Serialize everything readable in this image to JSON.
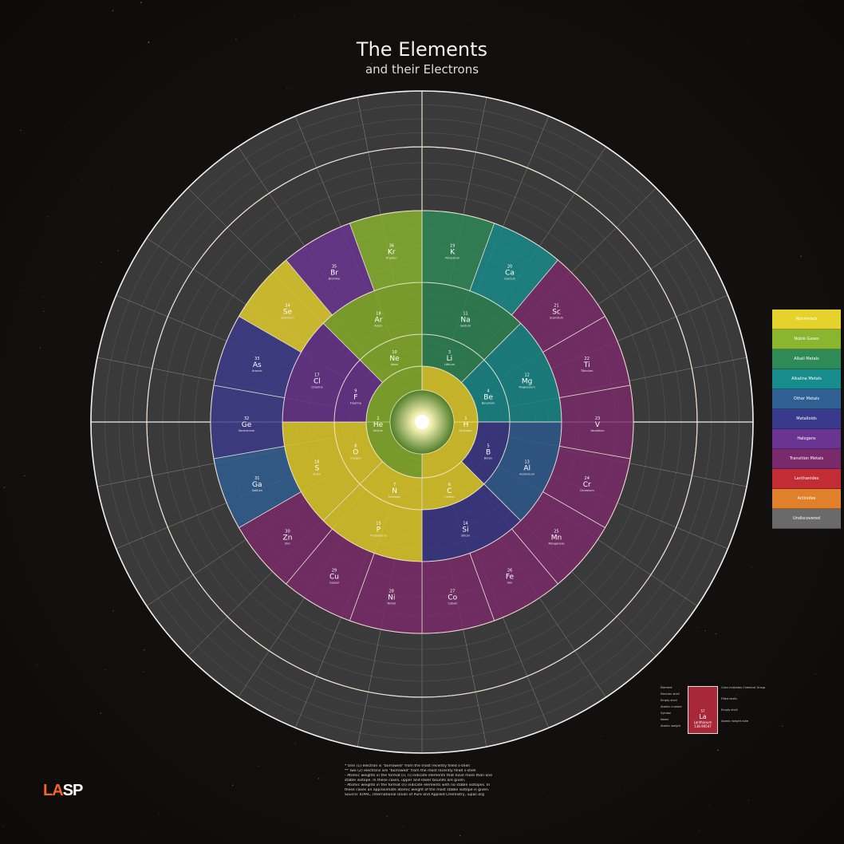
{
  "title": "The Elements",
  "subtitle": "and their Electrons",
  "legend": [
    {
      "label": "Nonmetals",
      "color": "#e6d22c"
    },
    {
      "label": "Noble Gases",
      "color": "#8ab52e"
    },
    {
      "label": "Alkali Metals",
      "color": "#2e8a57"
    },
    {
      "label": "Alkaline Metals",
      "color": "#178c8c"
    },
    {
      "label": "Other Metals",
      "color": "#2f5f93"
    },
    {
      "label": "Metalloids",
      "color": "#3a3a8c"
    },
    {
      "label": "Halogens",
      "color": "#6a3592"
    },
    {
      "label": "Transition Metals",
      "color": "#7a2a6a"
    },
    {
      "label": "Lanthanides",
      "color": "#c22d35"
    },
    {
      "label": "Actinides",
      "color": "#e0802a"
    },
    {
      "label": "Undiscovered",
      "color": "#6a6a6a"
    }
  ],
  "notes": [
    "* One (1) electron is \"borrowed\" from the most recently filled s-shell",
    "** Two (2) electrons are \"borrowed\" from the most recently filled s-shell",
    "- Atomic weights in the format [n, n] indicate elements that have more than one",
    "stable isotope. In these cases, upper and lower bounds are given.",
    "- Atomic weights in the format (n) indicate elements with no stable isotopes. In",
    "these cases an approximate atomic weight of the most stable isotope is given.",
    "Source: IUPAC, International Union of Pure and Applied Chemistry, iupac.org"
  ],
  "logo": {
    "a": "LA",
    "b": "SP"
  },
  "key": {
    "left": [
      "Element",
      "Electron shell",
      "Empty shell",
      "Atomic number",
      "Symbol",
      "Name",
      "Atomic weight"
    ],
    "right": [
      "Color indicates Chemical Group",
      "Filled shells",
      "Empty shell",
      "Atomic weight note"
    ],
    "sample": {
      "number": "57",
      "symbol": "La",
      "name": "Lanthanum",
      "weight": "138.90547"
    }
  },
  "elements": [
    {
      "z": "1",
      "sym": "H",
      "name": "Hydrogen",
      "c": "#e6d22c"
    },
    {
      "z": "2",
      "sym": "He",
      "name": "Helium",
      "c": "#8ab52e"
    },
    {
      "z": "3",
      "sym": "Li",
      "name": "Lithium",
      "c": "#2e8a57"
    },
    {
      "z": "4",
      "sym": "Be",
      "name": "Beryllium",
      "c": "#178c8c"
    },
    {
      "z": "5",
      "sym": "B",
      "name": "Boron",
      "c": "#3a3a8c"
    },
    {
      "z": "6",
      "sym": "C",
      "name": "Carbon",
      "c": "#e6d22c"
    },
    {
      "z": "7",
      "sym": "N",
      "name": "Nitrogen",
      "c": "#e6d22c"
    },
    {
      "z": "8",
      "sym": "O",
      "name": "Oxygen",
      "c": "#e6d22c"
    },
    {
      "z": "9",
      "sym": "F",
      "name": "Fluorine",
      "c": "#6a3592"
    },
    {
      "z": "10",
      "sym": "Ne",
      "name": "Neon",
      "c": "#8ab52e"
    },
    {
      "z": "11",
      "sym": "Na",
      "name": "Sodium",
      "c": "#2e8a57"
    },
    {
      "z": "12",
      "sym": "Mg",
      "name": "Magnesium",
      "c": "#178c8c"
    },
    {
      "z": "13",
      "sym": "Al",
      "name": "Aluminium",
      "c": "#2f5f93"
    },
    {
      "z": "14",
      "sym": "Si",
      "name": "Silicon",
      "c": "#3a3a8c"
    },
    {
      "z": "15",
      "sym": "P",
      "name": "Phosphorus",
      "c": "#e6d22c"
    },
    {
      "z": "16",
      "sym": "S",
      "name": "Sulfur",
      "c": "#e6d22c"
    },
    {
      "z": "17",
      "sym": "Cl",
      "name": "Chlorine",
      "c": "#6a3592"
    },
    {
      "z": "18",
      "sym": "Ar",
      "name": "Argon",
      "c": "#8ab52e"
    },
    {
      "z": "19",
      "sym": "K",
      "name": "Potassium",
      "c": "#2e8a57"
    },
    {
      "z": "20",
      "sym": "Ca",
      "name": "Calcium",
      "c": "#178c8c"
    },
    {
      "z": "21",
      "sym": "Sc",
      "name": "Scandium",
      "c": "#7a2a6a"
    },
    {
      "z": "22",
      "sym": "Ti",
      "name": "Titanium",
      "c": "#7a2a6a"
    },
    {
      "z": "23",
      "sym": "V",
      "name": "Vanadium",
      "c": "#7a2a6a"
    },
    {
      "z": "24",
      "sym": "Cr",
      "name": "Chromium",
      "c": "#7a2a6a"
    },
    {
      "z": "25",
      "sym": "Mn",
      "name": "Manganese",
      "c": "#7a2a6a"
    },
    {
      "z": "26",
      "sym": "Fe",
      "name": "Iron",
      "c": "#7a2a6a"
    },
    {
      "z": "27",
      "sym": "Co",
      "name": "Cobalt",
      "c": "#7a2a6a"
    },
    {
      "z": "28",
      "sym": "Ni",
      "name": "Nickel",
      "c": "#7a2a6a"
    },
    {
      "z": "29",
      "sym": "Cu",
      "name": "Copper",
      "c": "#7a2a6a"
    },
    {
      "z": "30",
      "sym": "Zn",
      "name": "Zinc",
      "c": "#7a2a6a"
    },
    {
      "z": "31",
      "sym": "Ga",
      "name": "Gallium",
      "c": "#2f5f93"
    },
    {
      "z": "32",
      "sym": "Ge",
      "name": "Germanium",
      "c": "#3a3a8c"
    },
    {
      "z": "33",
      "sym": "As",
      "name": "Arsenic",
      "c": "#3a3a8c"
    },
    {
      "z": "34",
      "sym": "Se",
      "name": "Selenium",
      "c": "#e6d22c"
    },
    {
      "z": "35",
      "sym": "Br",
      "name": "Bromine",
      "c": "#6a3592"
    },
    {
      "z": "36",
      "sym": "Kr",
      "name": "Krypton",
      "c": "#8ab52e"
    }
  ]
}
